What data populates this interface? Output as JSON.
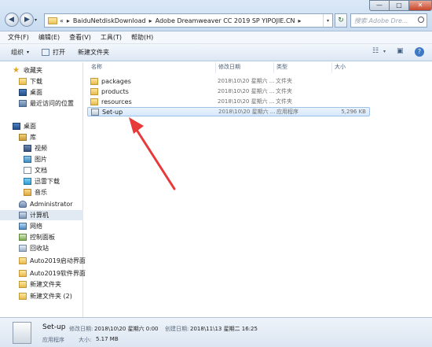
{
  "window": {
    "minimize_glyph": "—",
    "maximize_glyph": "□",
    "close_glyph": "✕"
  },
  "address": {
    "chevron": "«",
    "segments": [
      "BaiduNetdiskDownload",
      "Adobe Dreamweaver CC 2019 SP YIPOJIE.CN"
    ],
    "separator": "▸",
    "refresh_glyph": "↻"
  },
  "search": {
    "placeholder": "搜索 Adobe Dre..."
  },
  "menu": [
    "文件(F)",
    "编辑(E)",
    "查看(V)",
    "工具(T)",
    "帮助(H)"
  ],
  "toolbar": {
    "organize": "组织",
    "open": "打开",
    "new_folder": "新建文件夹",
    "caret": "▾",
    "view_glyph": "☷",
    "preview_glyph": "▣",
    "help_glyph": "?"
  },
  "sidebar": {
    "favorites": "收藏夹",
    "favorites_items": [
      "下载",
      "桌面",
      "最近访问的位置"
    ],
    "desktop": "桌面",
    "library": "库",
    "library_items": [
      "视频",
      "图片",
      "文档",
      "迅雷下载",
      "音乐"
    ],
    "others": [
      "Administrator",
      "计算机",
      "网络",
      "控制面板",
      "回收站",
      "Auto2019启动界面",
      "Auto2019软件界面",
      "新建文件夹",
      "新建文件夹 (2)"
    ]
  },
  "columns": {
    "name": "名称",
    "date": "修改日期",
    "type": "类型",
    "size": "大小"
  },
  "files": [
    {
      "name": "packages",
      "date": "2018\\10\\20 星期六 ...",
      "type": "文件夹",
      "size": ""
    },
    {
      "name": "products",
      "date": "2018\\10\\20 星期六 ...",
      "type": "文件夹",
      "size": ""
    },
    {
      "name": "resources",
      "date": "2018\\10\\20 星期六 ...",
      "type": "文件夹",
      "size": ""
    },
    {
      "name": "Set-up",
      "date": "2018\\10\\20 星期六 ...",
      "type": "应用程序",
      "size": "5,296 KB"
    }
  ],
  "details": {
    "name": "Set-up",
    "modified_label": "修改日期:",
    "modified_value": "2018\\10\\20 星期六 0:00",
    "created_label": "创建日期:",
    "created_value": "2018\\11\\13 星期二 16:25",
    "type": "应用程序",
    "size_label": "大小:",
    "size_value": "5.17 MB"
  },
  "colors": {
    "annotation_arrow": "#e8393a",
    "selection": "#d6e8fb"
  }
}
